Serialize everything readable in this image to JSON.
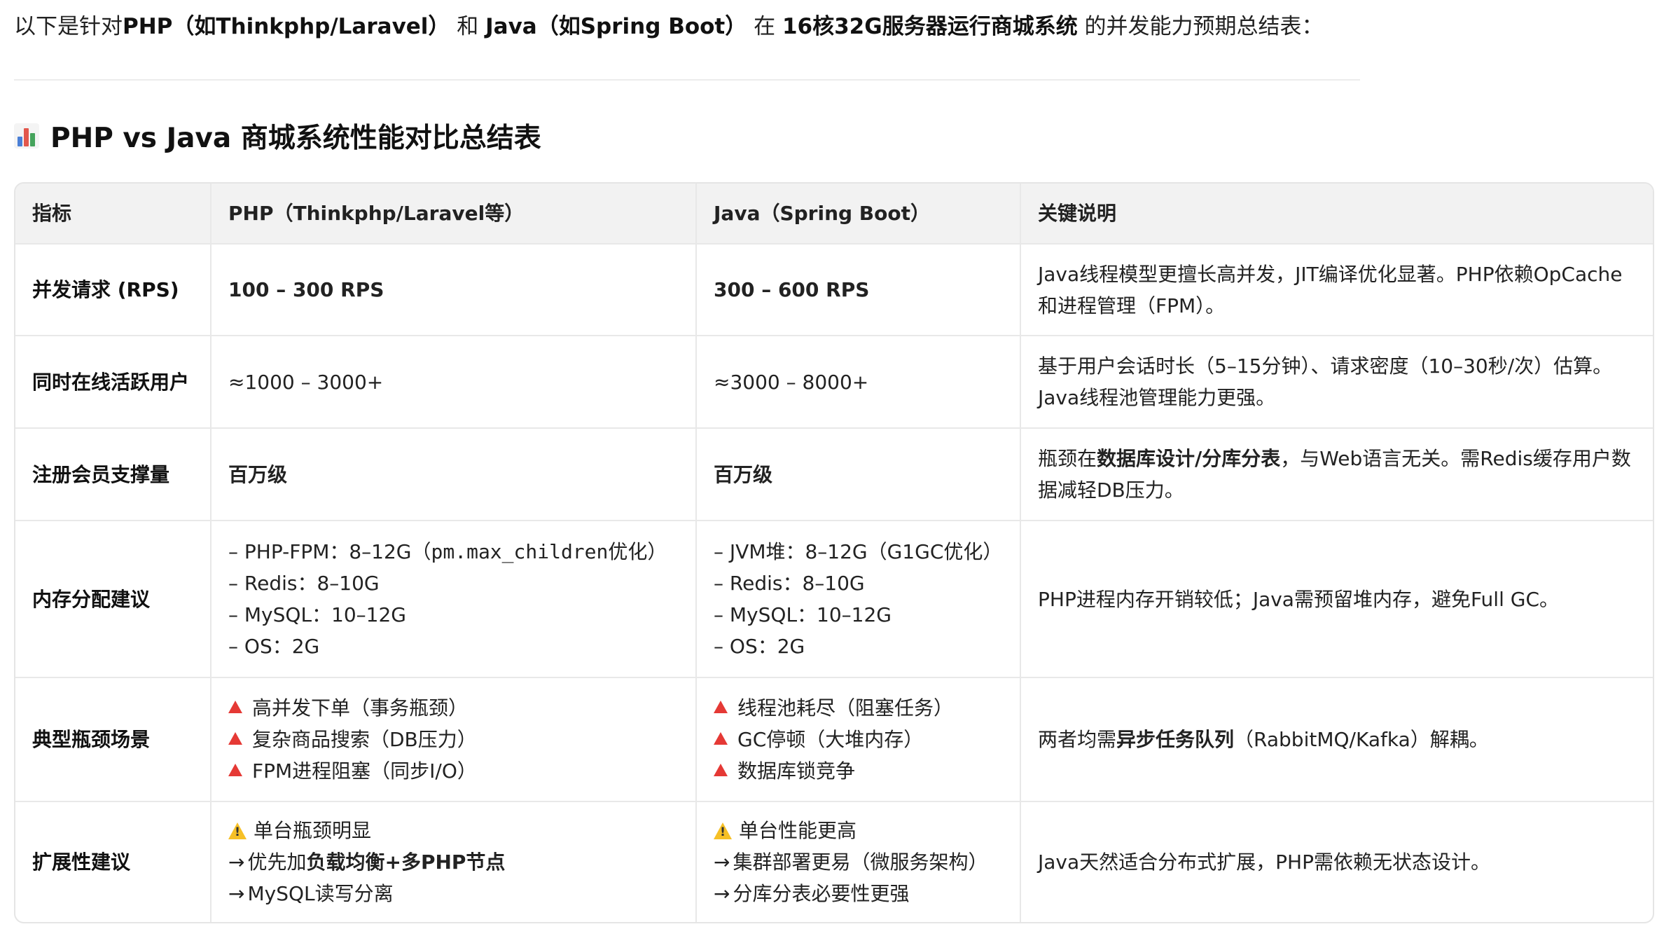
{
  "intro": {
    "prefix": "以下是针对",
    "php": "PHP（如Thinkphp/Laravel）",
    "and": " 和 ",
    "java": "Java（如Spring Boot）",
    "in": " 在 ",
    "server": "16核32G服务器运行商城系统",
    "suffix": " 的并发能力预期总结表："
  },
  "heading": {
    "icon": "bar-chart-icon",
    "title": "PHP vs Java 商城系统性能对比总结表"
  },
  "table": {
    "headers": [
      "指标",
      "PHP（Thinkphp/Laravel等）",
      "Java（Spring Boot）",
      "关键说明"
    ],
    "rows": {
      "rps": {
        "metric": "并发请求 (RPS)",
        "php": "100 – 300 RPS",
        "java": "300 – 600 RPS",
        "note": [
          "Java线程模型更擅长高并发，JIT编译优化显著。PHP依赖OpCache",
          "和进程管理（FPM）。"
        ]
      },
      "users": {
        "metric": "同时在线活跃用户",
        "php": "≈1000 – 3000+",
        "java": "≈3000 – 8000+",
        "note": [
          "基于用户会话时长（5–15分钟）、请求密度（10–30秒/次）估算。",
          "Java线程池管理能力更强。"
        ]
      },
      "members": {
        "metric": "注册会员支撑量",
        "php": "百万级",
        "java": "百万级",
        "note_prefix": "瓶颈在",
        "note_bold": "数据库设计/分库分表",
        "note_suffix": "，与Web语言无关。需Redis缓存用户数",
        "note_line2": "据减轻DB压力。"
      },
      "memory": {
        "metric": "内存分配建议",
        "php_fpm_prefix": "– PHP-FPM：8–12G（",
        "php_fpm_code": "pm.max_children",
        "php_fpm_suffix": "优化）",
        "php": [
          "– Redis：8–10G",
          "– MySQL：10–12G",
          "– OS：2G"
        ],
        "java": [
          "– JVM堆：8–12G（G1GC优化）",
          "– Redis：8–10G",
          "– MySQL：10–12G",
          "– OS：2G"
        ],
        "note": "PHP进程内存开销较低；Java需预留堆内存，避免Full GC。"
      },
      "bottleneck": {
        "metric": "典型瓶颈场景",
        "php": [
          "高并发下单（事务瓶颈）",
          "复杂商品搜索（DB压力）",
          "FPM进程阻塞（同步I/O）"
        ],
        "java": [
          "线程池耗尽（阻塞任务）",
          "GC停顿（大堆内存）",
          "数据库锁竞争"
        ],
        "note_prefix": "两者均需",
        "note_bold": "异步任务队列",
        "note_suffix": "（RabbitMQ/Kafka）解耦。"
      },
      "scaling": {
        "metric": "扩展性建议",
        "php_line1": "单台瓶颈明显",
        "php_line2_prefix": "优先加",
        "php_line2_bold": "负载均衡+多PHP节点",
        "php_line3": "MySQL读写分离",
        "java": [
          "单台性能更高",
          "集群部署更易（微服务架构）",
          "分库分表必要性更强"
        ],
        "note": "Java天然适合分布式扩展，PHP需依赖无状态设计。",
        "arrow": "→"
      }
    }
  }
}
